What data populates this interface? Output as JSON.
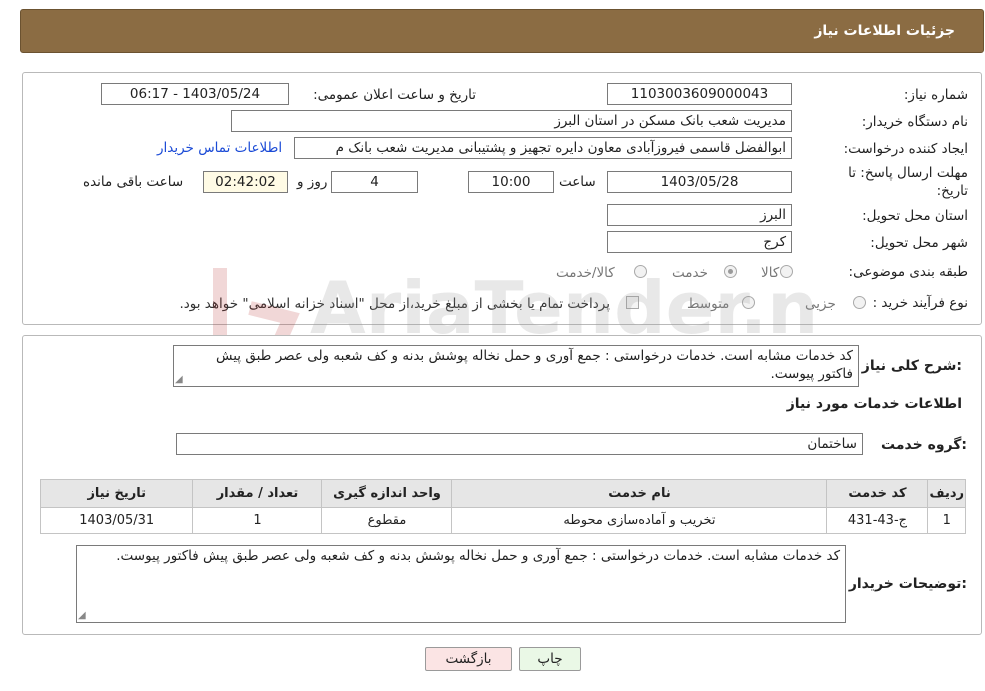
{
  "header": {
    "title": "جزئیات اطلاعات نیاز"
  },
  "form": {
    "need_number": {
      "label": "شماره نیاز:",
      "value": "1103003609000043"
    },
    "announce_datetime": {
      "label": "تاریخ و ساعت اعلان عمومی:",
      "value": "1403/05/24 - 06:17"
    },
    "buyer_org": {
      "label": "نام دستگاه خریدار:",
      "value": "مدیریت شعب بانک مسکن در استان البرز"
    },
    "requester": {
      "label": "ایجاد کننده درخواست:",
      "value": "ابوالفضل قاسمی فیروزآبادی معاون دایره تجهیز و پشتیبانی مدیریت شعب بانک م",
      "contact_link": "اطلاعات تماس خریدار"
    },
    "deadline": {
      "label_line1": "مهلت ارسال پاسخ: تا",
      "label_line2": "تاریخ:",
      "date": "1403/05/28",
      "time_label": "ساعت",
      "time": "10:00",
      "days": "4",
      "days_label": "روز و",
      "remaining": "02:42:02",
      "remaining_label": "ساعت باقی مانده"
    },
    "delivery_province": {
      "label": "استان محل تحویل:",
      "value": "البرز"
    },
    "delivery_city": {
      "label": "شهر محل تحویل:",
      "value": "کرج"
    },
    "category": {
      "label": "طبقه بندی موضوعی:",
      "options": [
        "کالا",
        "خدمت",
        "کالا/خدمت"
      ],
      "selected": "خدمت"
    },
    "purchase_type": {
      "label": "نوع فرآیند خرید :",
      "options": [
        "جزیی",
        "متوسط"
      ],
      "payment_note": "پرداخت تمام یا بخشی از مبلغ خرید،از محل \"اسناد خزانه اسلامی\" خواهد بود."
    }
  },
  "details": {
    "summary_label": "شرح کلی نیاز:",
    "summary_text": "کد خدمات مشابه است. خدمات درخواستی : جمع آوری و حمل نخاله پوشش بدنه و کف شعبه ولی عصر طبق پیش فاکتور پیوست.",
    "services_heading": "اطلاعات خدمات مورد نیاز",
    "service_group_label": "گروه خدمت:",
    "service_group_value": "ساختمان",
    "table": {
      "headers": [
        "ردیف",
        "کد خدمت",
        "نام خدمت",
        "واحد اندازه گیری",
        "تعداد / مقدار",
        "تاریخ نیاز"
      ],
      "rows": [
        [
          "1",
          "ج-43-431",
          "تخریب و آماده‌سازی محوطه",
          "مقطوع",
          "1",
          "1403/05/31"
        ]
      ]
    },
    "buyer_notes_label": "توضیحات خریدار:",
    "buyer_notes_text": "کد خدمات مشابه است. خدمات درخواستی : جمع آوری و حمل نخاله پوشش بدنه و کف شعبه ولی عصر طبق پیش فاکتور پیوست."
  },
  "buttons": {
    "print": "چاپ",
    "back": "بازگشت"
  },
  "colors": {
    "header_bg": "#8b6c43",
    "link": "#1a4ad6",
    "print_bg": "#eaf8e6",
    "back_bg": "#fbe4e4"
  },
  "watermark": {
    "text": "AriaTender.neT"
  }
}
